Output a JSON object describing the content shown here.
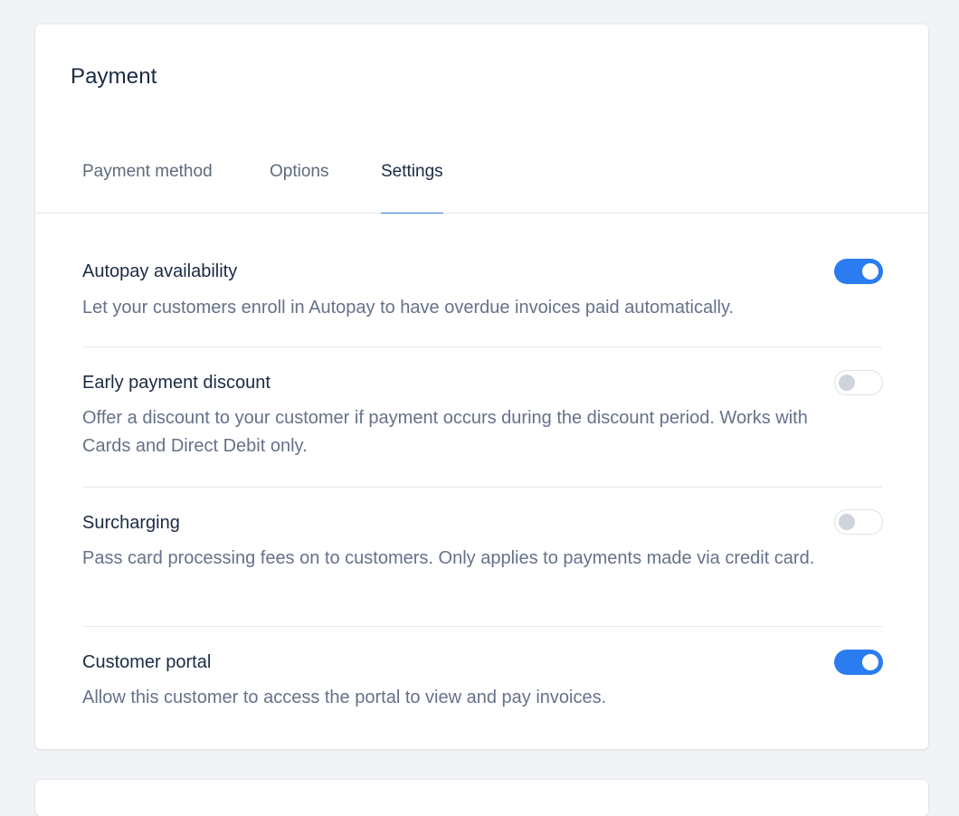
{
  "card": {
    "title": "Payment"
  },
  "tabs": [
    {
      "label": "Payment method",
      "active": false
    },
    {
      "label": "Options",
      "active": false
    },
    {
      "label": "Settings",
      "active": true
    }
  ],
  "settings": [
    {
      "title": "Autopay availability",
      "description": "Let your customers enroll in Autopay to have overdue invoices paid automatically.",
      "enabled": true
    },
    {
      "title": "Early payment discount",
      "description": "Offer a discount to your customer if payment occurs during the discount period. Works with Cards and Direct Debit only.",
      "enabled": false
    },
    {
      "title": "Surcharging",
      "description": "Pass card processing fees on to customers. Only applies to payments made via credit card.",
      "enabled": false
    },
    {
      "title": "Customer portal",
      "description": "Allow this customer to access the portal to view and pay invoices.",
      "enabled": true
    }
  ],
  "colors": {
    "toggle_on": "#2a7cf0",
    "toggle_off_knob": "#cfd4dc",
    "active_tab_underline": "#2b7bd3",
    "title_text": "#1b2a44",
    "description_text": "#66718a"
  },
  "icons": {
    "toggle_on": "toggle-on-icon",
    "toggle_off": "toggle-off-icon"
  }
}
